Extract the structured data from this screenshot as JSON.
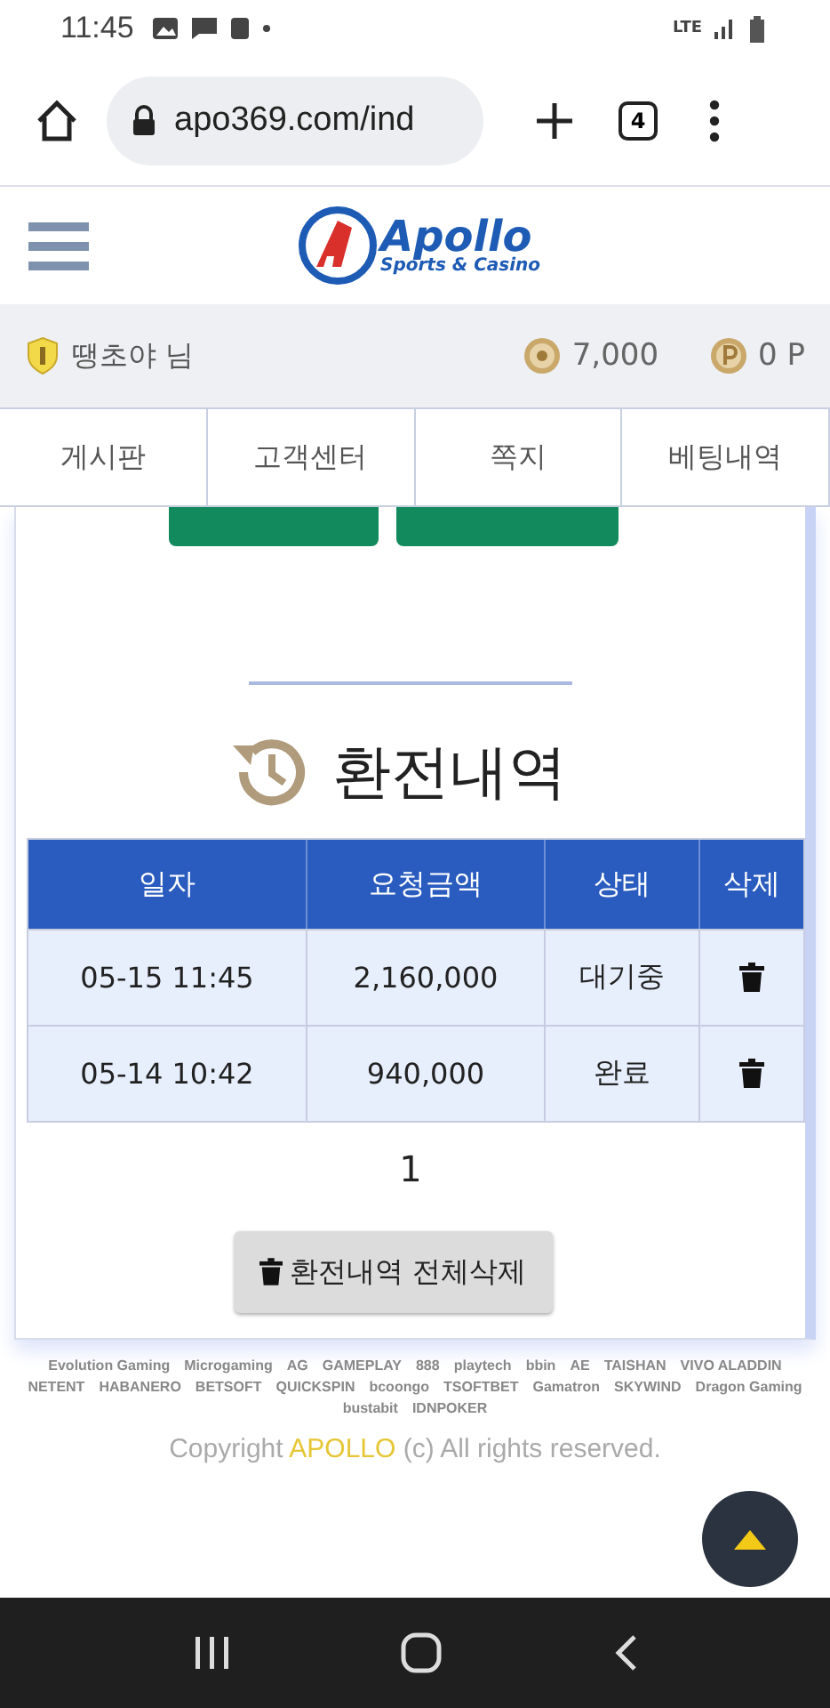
{
  "status_bar": {
    "time": "11:45",
    "network": "LTE"
  },
  "browser": {
    "url": "apo369.com/ind",
    "tab_count": "4"
  },
  "header": {
    "logo_title": "Apollo",
    "logo_subtitle": "Sports & Casino"
  },
  "user": {
    "name": "땡초야 님",
    "money": "7,000",
    "points": "0 P"
  },
  "tabs": [
    {
      "label": "게시판"
    },
    {
      "label": "고객센터"
    },
    {
      "label": "쪽지"
    },
    {
      "label": "베팅내역"
    }
  ],
  "section": {
    "title": "환전내역"
  },
  "table": {
    "columns": [
      "일자",
      "요청금액",
      "상태",
      "삭제"
    ],
    "rows": [
      {
        "date": "05-15 11:45",
        "amount": "2,160,000",
        "status": "대기중"
      },
      {
        "date": "05-14 10:42",
        "amount": "940,000",
        "status": "완료"
      }
    ]
  },
  "pagination": {
    "pages": [
      {
        "label": "1",
        "selected": true
      }
    ]
  },
  "delete_all_button": "환전내역 전체삭제",
  "providers": [
    "Evolution Gaming",
    "Microgaming",
    "AG",
    "GAMEPLAY",
    "888",
    "playtech",
    "bbin",
    "AE",
    "TAISHAN",
    "VIVO ALADDIN",
    "NETENT",
    "HABANERO",
    "BETSOFT",
    "QUICKSPIN",
    "bcoongo",
    "TSOFTBET",
    "Gamatron",
    "SKYWIND",
    "Dragon Gaming",
    "bustabit",
    "IDNPOKER"
  ],
  "footer": {
    "copyright_before": "Copyright ",
    "brand": "APOLLO",
    "copyright_after": " (c) All rights reserved."
  }
}
